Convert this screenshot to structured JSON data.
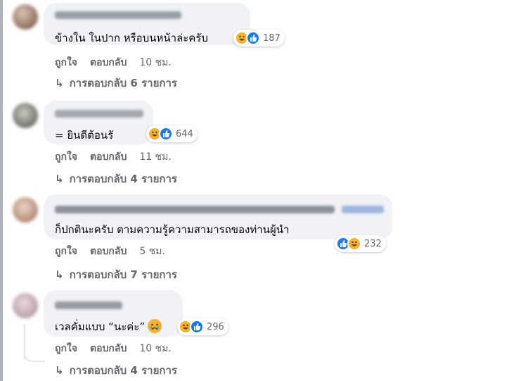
{
  "comments": [
    {
      "text": "ข้างใน ในปาก หรือบนหน้าล่ะครับ",
      "reaction_count": "187",
      "like_label": "ถูกใจ",
      "reply_label": "ตอบกลับ",
      "time": "10 ชม.",
      "replies_text": "การตอบกลับ 6 รายการ",
      "reactions": [
        "haha-icon",
        "like-icon"
      ]
    },
    {
      "text": "= ยินดีต้อนรั",
      "reaction_count": "644",
      "like_label": "ถูกใจ",
      "reply_label": "ตอบกลับ",
      "time": "11 ชม.",
      "replies_text": "การตอบกลับ 4 รายการ",
      "reactions": [
        "haha-icon",
        "like-icon"
      ]
    },
    {
      "text": "ก็ปกตินะครับ ตามความรู้ความสามารถของท่านผู้นำ",
      "reaction_count": "232",
      "like_label": "ถูกใจ",
      "reply_label": "ตอบกลับ",
      "time": "5 ชม.",
      "replies_text": "การตอบกลับ 7 รายการ",
      "reactions": [
        "like-icon",
        "haha-icon"
      ]
    },
    {
      "text": "เวลคั่มแบบ “นะค่ะ”",
      "reaction_count": "296",
      "like_label": "ถูกใจ",
      "reply_label": "ตอบกลับ",
      "time": "10 ชม.",
      "replies_text": "การตอบกลับ 4 รายการ",
      "reactions": [
        "haha-icon",
        "like-icon"
      ],
      "inline_emoji": "crying-face-icon"
    }
  ],
  "colors": {
    "bubble": "#f0f2f5",
    "meta_text": "#65676b",
    "like_blue": "#1877f2",
    "haha_yellow": "#f7b125"
  },
  "reply_arrow_icon": "reply-arrow-icon"
}
